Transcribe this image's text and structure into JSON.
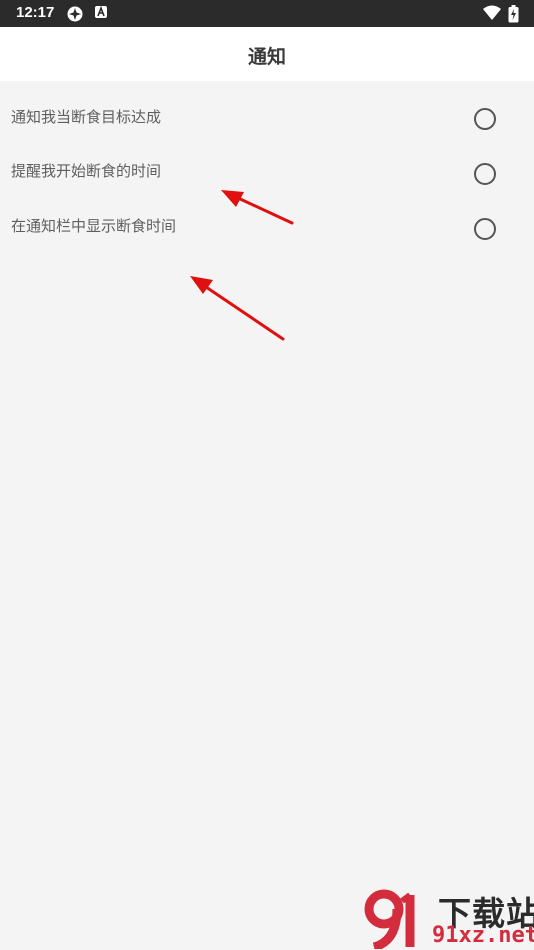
{
  "status_bar": {
    "time": "12:17",
    "icons": [
      "gear-notification-icon",
      "a-notification-icon",
      "wifi-icon",
      "battery-charging-icon"
    ]
  },
  "header": {
    "title": "通知"
  },
  "settings": [
    {
      "label": "通知我当断食目标达成",
      "checked": false
    },
    {
      "label": "提醒我开始断食的时间",
      "checked": false
    },
    {
      "label": "在通知栏中显示断食时间",
      "checked": false
    }
  ],
  "annotations": {
    "arrow_color": "#e01010"
  },
  "watermark": {
    "line1": "下载站",
    "line2": "91xz.net",
    "accent": "#d32c3c"
  }
}
